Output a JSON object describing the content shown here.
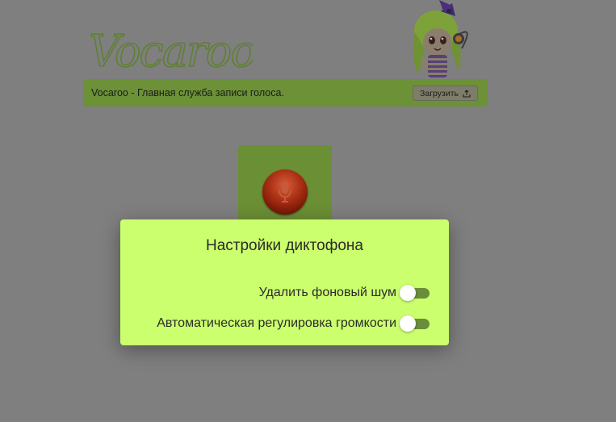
{
  "app": {
    "logo_text": "Vocaroo"
  },
  "header": {
    "tagline": "Vocaroo - Главная служба записи голоса.",
    "upload_label": "Загрузить"
  },
  "recorder": {
    "record_icon": "microphone-icon"
  },
  "modal": {
    "title": "Настройки диктофона",
    "settings": [
      {
        "label": "Удалить фоновый шум",
        "enabled": false
      },
      {
        "label": "Автоматическая регулировка громкости",
        "enabled": false
      }
    ]
  },
  "colors": {
    "page_background_dimmed": "#7f7f7f",
    "accent_green": "#6c9136",
    "modal_background": "#cbff6d",
    "record_red": "#a72d12"
  },
  "icons": {
    "upload": "upload-icon",
    "mic": "microphone-icon",
    "mascot": "mascot-image"
  }
}
